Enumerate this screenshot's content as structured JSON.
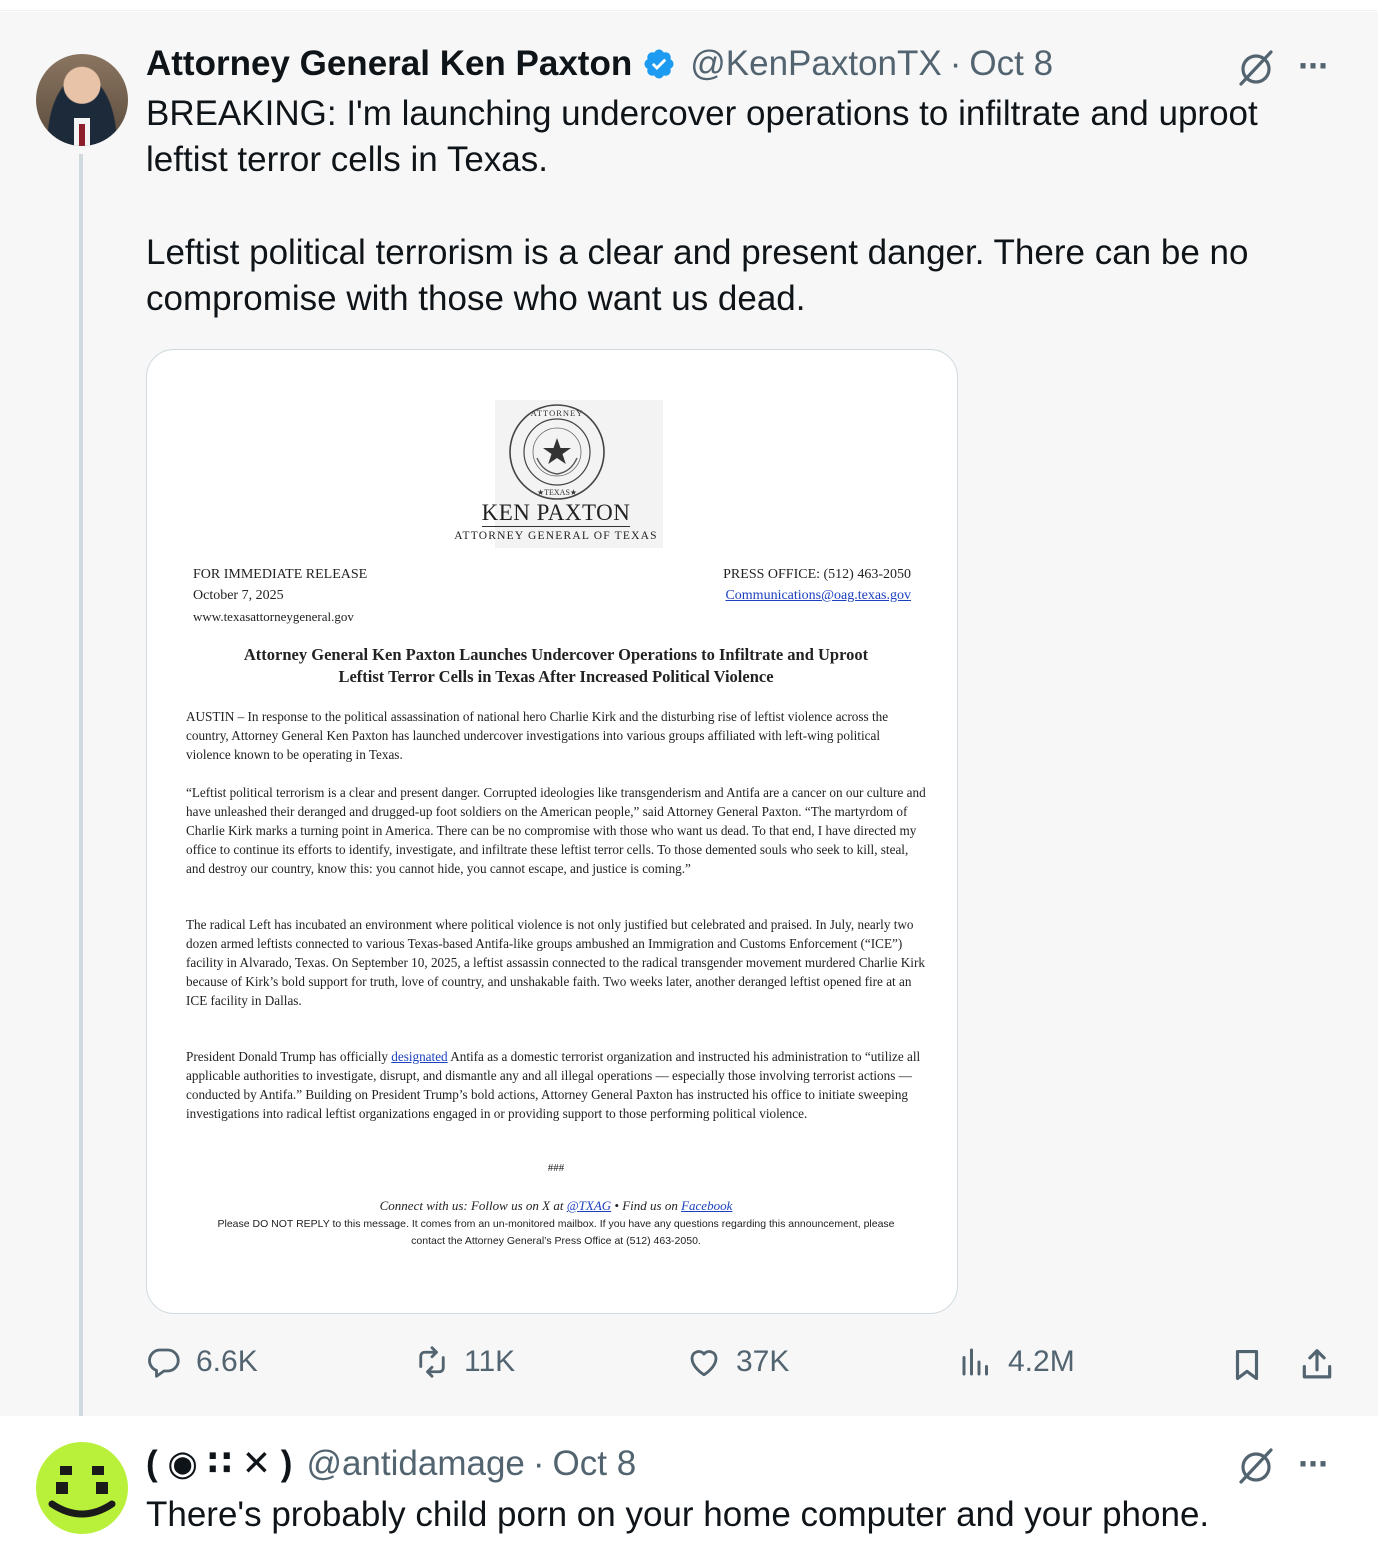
{
  "tweet1": {
    "name": "Attorney General Ken Paxton",
    "handle": "@KenPaxtonTX",
    "date": "Oct 8",
    "paragraph1": "BREAKING: I'm launching undercover operations to infiltrate and uproot leftist terror cells in Texas.",
    "paragraph2": "Leftist political terrorism is a clear and present danger. There can be no compromise with those who want us dead.",
    "metrics": {
      "replies": "6.6K",
      "reposts": "11K",
      "likes": "37K",
      "views": "4.2M"
    },
    "verified_color": "#1d9bf0"
  },
  "press_release": {
    "seal_text": "THE ATTORNEY GENERAL ★ TEXAS ★",
    "name": "KEN PAXTON",
    "subtitle": "ATTORNEY GENERAL OF TEXAS",
    "release_line": "FOR IMMEDIATE RELEASE",
    "date": "October 7, 2025",
    "website": "www.texasattorneygeneral.gov",
    "press_office": "PRESS OFFICE: (512) 463-2050",
    "email": "Communications@oag.texas.gov",
    "title_line1": "Attorney General Ken Paxton Launches Undercover Operations to Infiltrate and Uproot",
    "title_line2": "Leftist Terror Cells in Texas After Increased Political Violence",
    "para1": "AUSTIN – In response to the political assassination of national hero Charlie Kirk and the disturbing rise of leftist violence across the country, Attorney General Ken Paxton has launched undercover investigations into various groups affiliated with left-wing political violence known to be operating in Texas.",
    "para2": "“Leftist political terrorism is a clear and present danger. Corrupted ideologies like transgenderism and Antifa are a cancer on our culture and have unleashed their deranged and drugged-up foot soldiers on the American people,” said Attorney General Paxton. “The martyrdom of Charlie Kirk marks a turning point in America. There can be no compromise with those who want us dead. To that end, I have directed my office to continue its efforts to identify, investigate, and infiltrate these leftist terror cells. To those demented souls who seek to kill, steal, and destroy our country, know this: you cannot hide, you cannot escape, and justice is coming.”",
    "para3": "The radical Left has incubated an environment where political violence is not only justified but celebrated and praised. In July, nearly two dozen armed leftists connected to various Texas-based Antifa-like groups ambushed an Immigration and Customs Enforcement (“ICE”) facility in Alvarado, Texas. On September 10, 2025, a leftist assassin connected to the radical transgender movement murdered Charlie Kirk because of Kirk’s bold support for truth, love of country, and unshakable faith. Two weeks later, another deranged leftist opened fire at an ICE facility in Dallas.",
    "para4_before": "President Donald Trump has officially ",
    "para4_link": "designated",
    "para4_after": " Antifa as a domestic terrorist organization and instructed his administration to “utilize all applicable authorities to investigate, disrupt, and dismantle any and all illegal operations — especially those involving terrorist actions — conducted by Antifa.” Building on President Trump’s bold actions, Attorney General Paxton has instructed his office to initiate sweeping investigations into radical leftist organizations engaged in or providing support to those performing political violence.",
    "end_mark": "###",
    "connect_prefix": "Connect with us: Follow us on X at ",
    "connect_x": "@TXAG",
    "connect_mid": " • Find us on ",
    "connect_fb": "Facebook",
    "footer_note": "Please DO NOT REPLY to this message. It comes from an un-monitored mailbox. If you have any questions regarding this announcement, please contact the Attorney General’s Press Office at (512) 463-2050."
  },
  "tweet2": {
    "name": "( ◉ ∷ ✕ )",
    "handle": "@antidamage",
    "date": "Oct 8",
    "text": "There's probably child porn on your home computer and your phone.",
    "avatar_color": "#b8f03a"
  },
  "icons": {
    "grok": "grok-icon",
    "more": "more-icon",
    "reply": "reply-icon",
    "repost": "repost-icon",
    "like": "like-icon",
    "views": "views-icon",
    "bookmark": "bookmark-icon",
    "share": "share-icon"
  }
}
